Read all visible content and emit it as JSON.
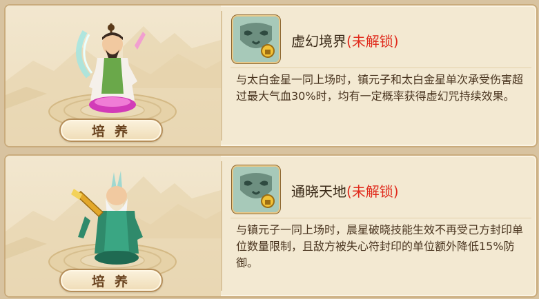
{
  "colors": {
    "lock_red": "#e02a1c",
    "text_brown": "#4a3520",
    "panel_bg": "#f3e9d2",
    "border": "#c9ab7c"
  },
  "cards": [
    {
      "hero_icon": "hero-zhenyuanzi-icon",
      "train_label": "培养",
      "skill_icon": "mask-skill-icon",
      "skill_name": "虚幻境界",
      "lock_status": "(未解锁)",
      "description": "与太白金星一同上场时，镇元子和太白金星单次承受伤害超过最大气血30%时，均有一定概率获得虚幻咒持续效果。"
    },
    {
      "hero_icon": "hero-taibai-icon",
      "train_label": "培养",
      "skill_icon": "mask-skill-icon",
      "skill_name": "通晓天地",
      "lock_status": "(未解锁)",
      "description": "与镇元子一同上场时，晨星破晓技能生效不再受己方封印单位数量限制，且敌方被失心符封印的单位额外降低15%防御。"
    }
  ]
}
